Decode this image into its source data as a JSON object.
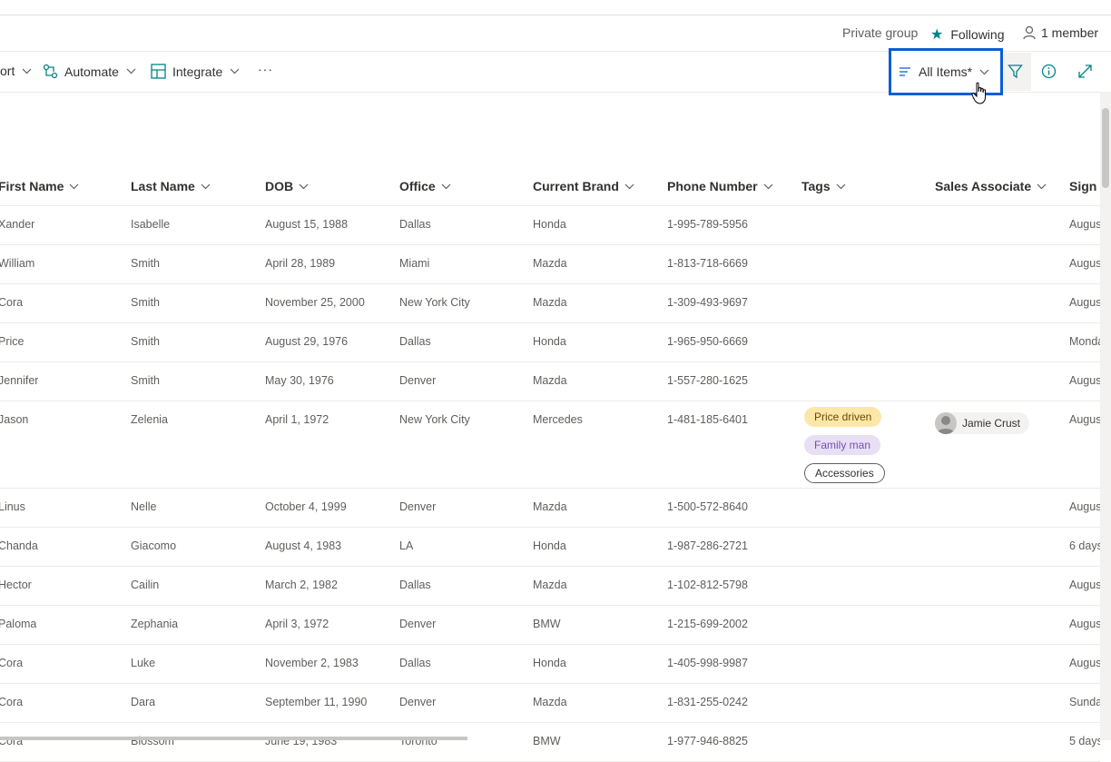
{
  "group_bar": {
    "privacy": "Private group",
    "following": "Following",
    "members": "1 member"
  },
  "command_bar": {
    "export_partial": "ort",
    "automate": "Automate",
    "integrate": "Integrate",
    "more": "···",
    "view_selector": "All Items*"
  },
  "columns": [
    "First Name",
    "Last Name",
    "DOB",
    "Office",
    "Current Brand",
    "Phone Number",
    "Tags",
    "Sales Associate",
    "Sign U"
  ],
  "rows": [
    {
      "first": "Xander",
      "last": "Isabelle",
      "dob": "August 15, 1988",
      "office": "Dallas",
      "brand": "Honda",
      "phone": "1-995-789-5956",
      "sign": "August"
    },
    {
      "first": "William",
      "last": "Smith",
      "dob": "April 28, 1989",
      "office": "Miami",
      "brand": "Mazda",
      "phone": "1-813-718-6669",
      "sign": "August"
    },
    {
      "first": "Cora",
      "last": "Smith",
      "dob": "November 25, 2000",
      "office": "New York City",
      "brand": "Mazda",
      "phone": "1-309-493-9697",
      "sign": "August"
    },
    {
      "first": "Price",
      "last": "Smith",
      "dob": "August 29, 1976",
      "office": "Dallas",
      "brand": "Honda",
      "phone": "1-965-950-6669",
      "sign": "Monday"
    },
    {
      "first": "Jennifer",
      "last": "Smith",
      "dob": "May 30, 1976",
      "office": "Denver",
      "brand": "Mazda",
      "phone": "1-557-280-1625",
      "sign": "August"
    },
    {
      "first": "Jason",
      "last": "Zelenia",
      "dob": "April 1, 1972",
      "office": "New York City",
      "brand": "Mercedes",
      "phone": "1-481-185-6401",
      "sign": "August",
      "tags": [
        "Price driven",
        "Family man",
        "Accessories"
      ],
      "associate": "Jamie Crust"
    },
    {
      "first": "Linus",
      "last": "Nelle",
      "dob": "October 4, 1999",
      "office": "Denver",
      "brand": "Mazda",
      "phone": "1-500-572-8640",
      "sign": "August"
    },
    {
      "first": "Chanda",
      "last": "Giacomo",
      "dob": "August 4, 1983",
      "office": "LA",
      "brand": "Honda",
      "phone": "1-987-286-2721",
      "sign": "6 days"
    },
    {
      "first": "Hector",
      "last": "Cailin",
      "dob": "March 2, 1982",
      "office": "Dallas",
      "brand": "Mazda",
      "phone": "1-102-812-5798",
      "sign": "August"
    },
    {
      "first": "Paloma",
      "last": "Zephania",
      "dob": "April 3, 1972",
      "office": "Denver",
      "brand": "BMW",
      "phone": "1-215-699-2002",
      "sign": "August"
    },
    {
      "first": "Cora",
      "last": "Luke",
      "dob": "November 2, 1983",
      "office": "Dallas",
      "brand": "Honda",
      "phone": "1-405-998-9987",
      "sign": "August"
    },
    {
      "first": "Cora",
      "last": "Dara",
      "dob": "September 11, 1990",
      "office": "Denver",
      "brand": "Mazda",
      "phone": "1-831-255-0242",
      "sign": "Sunday"
    },
    {
      "first": "Cora",
      "last": "Blossom",
      "dob": "June 19, 1983",
      "office": "Toronto",
      "brand": "BMW",
      "phone": "1-977-946-8825",
      "sign": "5 days"
    }
  ],
  "colors": {
    "accent": "#038387",
    "highlight": "#0a5ed7",
    "tag_price": "#fce7a8",
    "tag_family": "#e8dff5"
  }
}
